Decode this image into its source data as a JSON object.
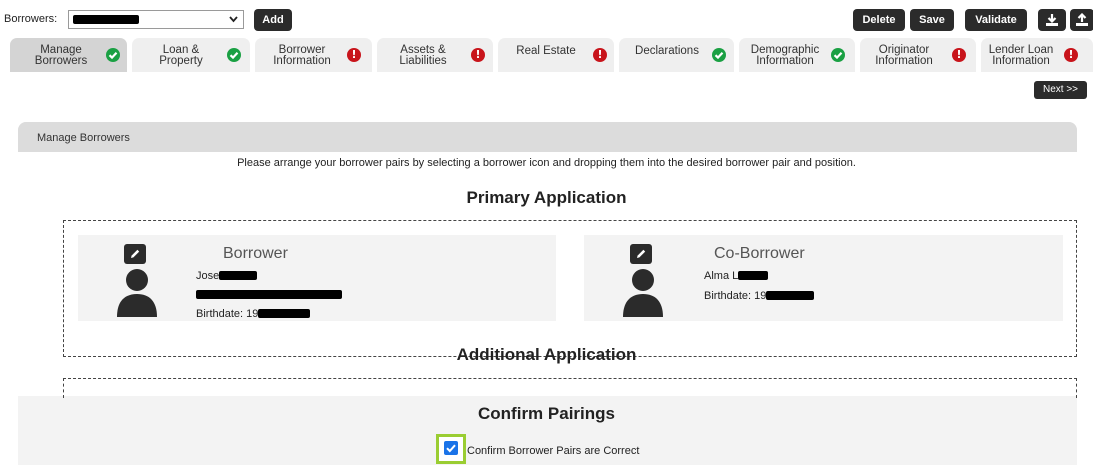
{
  "toolbar": {
    "borrowers_label": "Borrowers:",
    "add_label": "Add",
    "delete_label": "Delete",
    "save_label": "Save",
    "validate_label": "Validate"
  },
  "tabs": [
    {
      "line1": "Manage",
      "line2": "Borrowers",
      "status": "ok"
    },
    {
      "line1": "Loan &",
      "line2": "Property",
      "status": "ok"
    },
    {
      "line1": "Borrower",
      "line2": "Information",
      "status": "error"
    },
    {
      "line1": "Assets &",
      "line2": "Liabilities",
      "status": "error"
    },
    {
      "line1": "Real Estate",
      "line2": "",
      "status": "error"
    },
    {
      "line1": "Declarations",
      "line2": "",
      "status": "ok"
    },
    {
      "line1": "Demographic",
      "line2": "Information",
      "status": "ok"
    },
    {
      "line1": "Originator",
      "line2": "Information",
      "status": "error"
    },
    {
      "line1": "Lender Loan",
      "line2": "Information",
      "status": "error"
    }
  ],
  "next_label": "Next >>",
  "panel": {
    "title": "Manage Borrowers",
    "instruction": "Please arrange your borrower pairs by selecting a borrower icon and dropping them into the desired borrower pair and position.",
    "primary_title": "Primary Application",
    "additional_title": "Additional Application",
    "confirm_title": "Confirm Pairings",
    "confirm_label": "Confirm Borrower Pairs are Correct",
    "confirm_checked": true
  },
  "borrower_card": {
    "role": "Borrower",
    "name_visible": "Jose",
    "birthdate_prefix": "Birthdate: 19"
  },
  "coborrower_card": {
    "role": "Co-Borrower",
    "name_visible": "Alma L",
    "birthdate_prefix": "Birthdate: 19"
  }
}
